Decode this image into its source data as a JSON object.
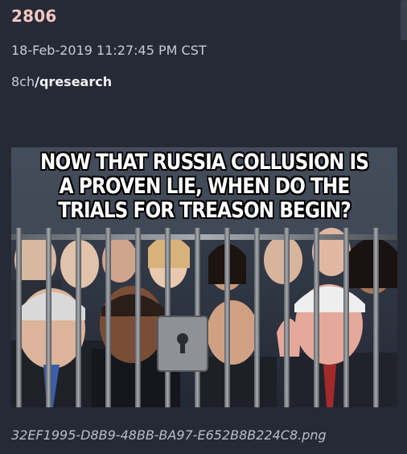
{
  "post": {
    "number": "2806",
    "timestamp": "18-Feb-2019 11:27:45 PM CST",
    "source_site": "8ch",
    "source_board": "/qresearch",
    "image_caption": "NOW THAT RUSSIA COLLUSION IS A PROVEN LIE, WHEN DO THE TRIALS FOR TREASON BEGIN?",
    "filename": "32EF1995-D8B9-48BB-BA97-E652B8B224C8.png"
  },
  "colors": {
    "background": "#262a35",
    "post_number": "#f4c7c3",
    "text": "#c8ccd4"
  }
}
